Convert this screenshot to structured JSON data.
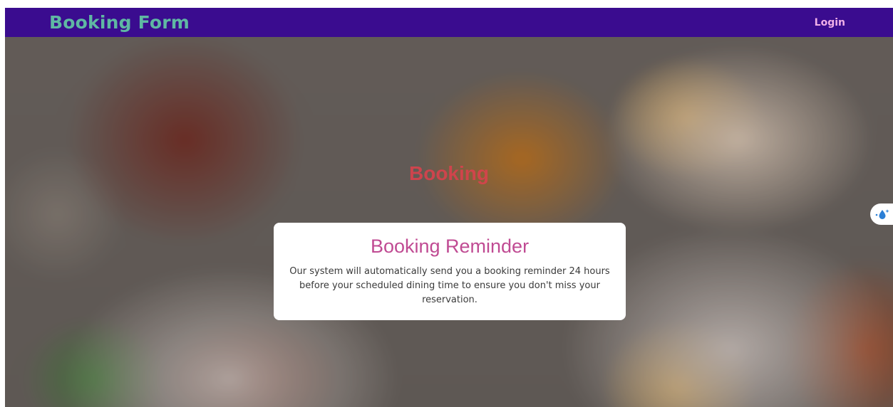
{
  "navbar": {
    "brand": "Booking Form",
    "login_label": "Login"
  },
  "hero": {
    "title": "Booking"
  },
  "reminder": {
    "title": "Booking Reminder",
    "text": "Our system will automatically send you a booking reminder 24 hours before your scheduled dining time to ensure you don't miss your reservation."
  },
  "side_widget": {
    "icon": "water-drop-sparkle-icon"
  },
  "colors": {
    "navbar_bg": "#3a0c8f",
    "brand": "#5fb8a3",
    "login": "#f0b0e8",
    "hero_title": "#d9424d",
    "reminder_title": "#c04b93"
  }
}
